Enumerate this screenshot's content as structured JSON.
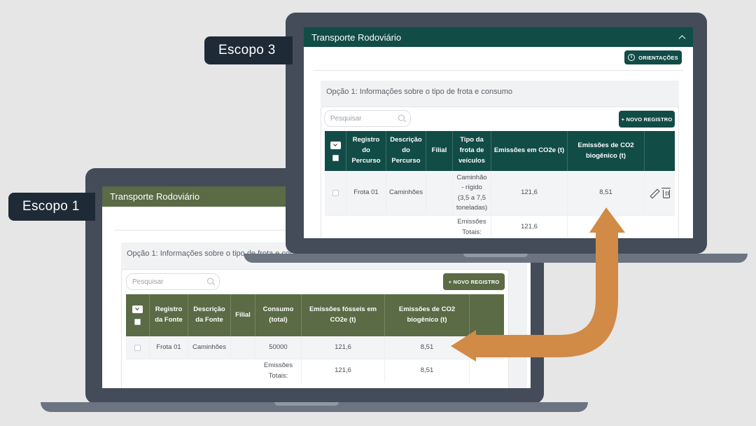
{
  "scope1": {
    "label": "Escopo 1",
    "panel_title": "Transporte Rodoviário",
    "option_title": "Opção 1: Informações sobre o tipo de frota e consumo",
    "search_placeholder": "Pesquisar",
    "new_record_label": "+ NOVO REGISTRO",
    "columns": [
      "Registro da Fonte",
      "Descrição da Fonte",
      "Filial",
      "Consumo (total)",
      "Emissões fósseis em CO2e (t)",
      "Emissões de CO2 biogênico (t)"
    ],
    "rows": [
      {
        "registro": "Frota 01",
        "descricao": "Caminhões",
        "filial": "",
        "consumo": "50000",
        "fosseis": "121,6",
        "biogenico": "8,51"
      }
    ],
    "totals": {
      "label": "Emissões Totais:",
      "fosseis": "121,6",
      "biogenico": "8,51"
    }
  },
  "scope3": {
    "label": "Escopo 3",
    "panel_title": "Transporte Rodoviário",
    "guidance_label": "ORIENTAÇÕES",
    "option_title": "Opção 1: Informações sobre o tipo de frota e consumo",
    "search_placeholder": "Pesquisar",
    "new_record_label": "+ NOVO REGISTRO",
    "columns": [
      "Registro do Percurso",
      "Descrição do Percurso",
      "Filial",
      "Tipo da frota de veículos",
      "Emissões em CO2e (t)",
      "Emissões de CO2 biogênico (t)"
    ],
    "rows": [
      {
        "registro": "Frota 01",
        "descricao": "Caminhões",
        "filial": "",
        "tipo": "Caminhão - rígido (3,5 a 7,5 toneladas)",
        "emissoes": "121,6",
        "biogenico": "8,51"
      }
    ],
    "totals": {
      "label": "Emissões Totais:",
      "emissoes": "121,6"
    }
  },
  "colors": {
    "scope1_header": "#5a6b45",
    "scope3_header": "#124c47",
    "arrow": "#d28a47",
    "laptop_bezel": "#434c58",
    "label_bg": "#1f2a37"
  }
}
